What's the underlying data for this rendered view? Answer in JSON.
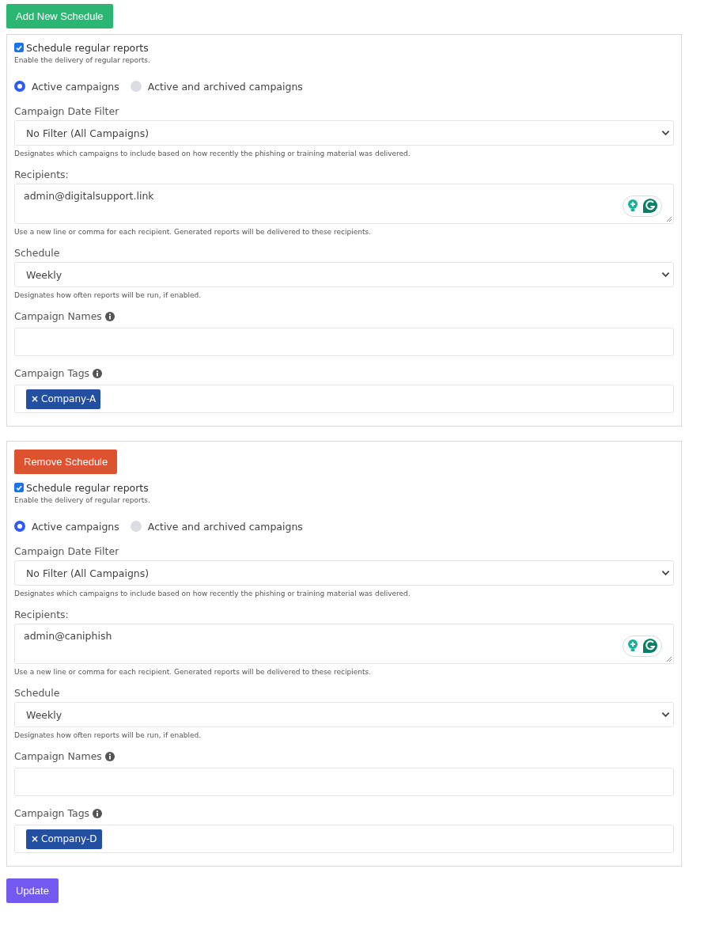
{
  "add_button": "Add New Schedule",
  "schedules": [
    {
      "enable": {
        "label": "Schedule regular reports",
        "checked": true,
        "help": "Enable the delivery of regular reports."
      },
      "scope": [
        {
          "label": "Active campaigns",
          "selected": true
        },
        {
          "label": "Active and archived campaigns",
          "selected": false
        }
      ],
      "date_filter": {
        "label": "Campaign Date Filter",
        "value": "No Filter (All Campaigns)",
        "help": "Designates which campaigns to include based on how recently the phishing or training material was delivered."
      },
      "recipients": {
        "label": "Recipients:",
        "value": "admin@digitalsupport.link",
        "help": "Use a new line or comma for each recipient. Generated reports will be delivered to these recipients."
      },
      "schedule": {
        "label": "Schedule",
        "value": "Weekly",
        "help": "Designates how often reports will be run, if enabled."
      },
      "campaign_names": {
        "label": "Campaign Names"
      },
      "campaign_tags": {
        "label": "Campaign Tags",
        "tags": [
          {
            "remove": "×",
            "label": "Company-A"
          }
        ]
      }
    },
    {
      "remove_button": "Remove Schedule",
      "enable": {
        "label": "Schedule regular reports",
        "checked": true,
        "help": "Enable the delivery of regular reports."
      },
      "scope": [
        {
          "label": "Active campaigns",
          "selected": true
        },
        {
          "label": "Active and archived campaigns",
          "selected": false
        }
      ],
      "date_filter": {
        "label": "Campaign Date Filter",
        "value": "No Filter (All Campaigns)",
        "help": "Designates which campaigns to include based on how recently the phishing or training material was delivered."
      },
      "recipients": {
        "label": "Recipients:",
        "value": "admin@caniphish",
        "help": "Use a new line or comma for each recipient. Generated reports will be delivered to these recipients."
      },
      "schedule": {
        "label": "Schedule",
        "value": "Weekly",
        "help": "Designates how often reports will be run, if enabled."
      },
      "campaign_names": {
        "label": "Campaign Names"
      },
      "campaign_tags": {
        "label": "Campaign Tags",
        "tags": [
          {
            "remove": "×",
            "label": "Company-D"
          }
        ]
      }
    }
  ],
  "update_button": "Update"
}
